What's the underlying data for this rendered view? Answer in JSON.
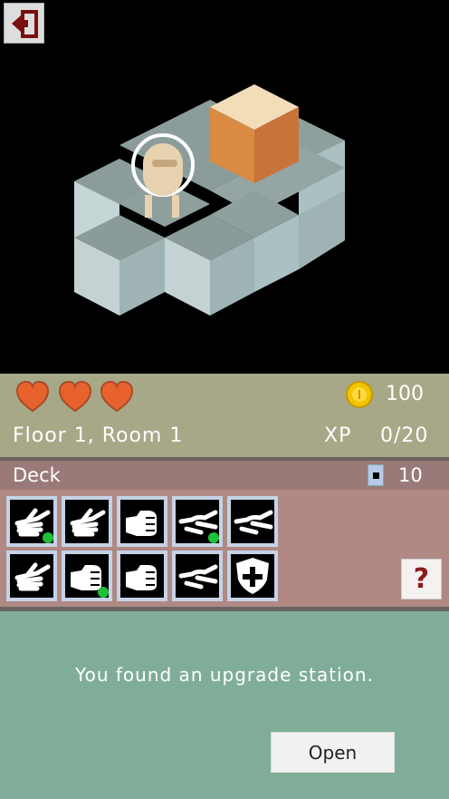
{
  "hud": {
    "gold": "100",
    "floor_room": "Floor 1, Room 1",
    "xp_label": "XP",
    "xp_value": "0/20",
    "hearts": 3
  },
  "deck": {
    "label": "Deck",
    "count": "10"
  },
  "cards": [
    {
      "icon": "open-hand-card-icon",
      "upgraded": true
    },
    {
      "icon": "open-hand-card-icon",
      "upgraded": false
    },
    {
      "icon": "fist-card-icon",
      "upgraded": false
    },
    {
      "icon": "scissors-card-icon",
      "upgraded": true
    },
    {
      "icon": "scissors-card-icon",
      "upgraded": false
    },
    {
      "icon": "open-hand-card-icon",
      "upgraded": false
    },
    {
      "icon": "fist-card-icon",
      "upgraded": true
    },
    {
      "icon": "fist-card-icon",
      "upgraded": false
    },
    {
      "icon": "scissors-card-icon",
      "upgraded": false
    },
    {
      "icon": "shield-card-icon",
      "upgraded": false
    }
  ],
  "help": {
    "label": "?"
  },
  "message": {
    "text": "You found an upgrade station.",
    "button": "Open"
  },
  "colors": {
    "hud_bg": "#a7a887",
    "deck_bg": "#9a7a78",
    "cards_bg": "#b08984",
    "message_bg": "#80ad98",
    "heart": "#e8622e",
    "coin": "#f5c400"
  }
}
